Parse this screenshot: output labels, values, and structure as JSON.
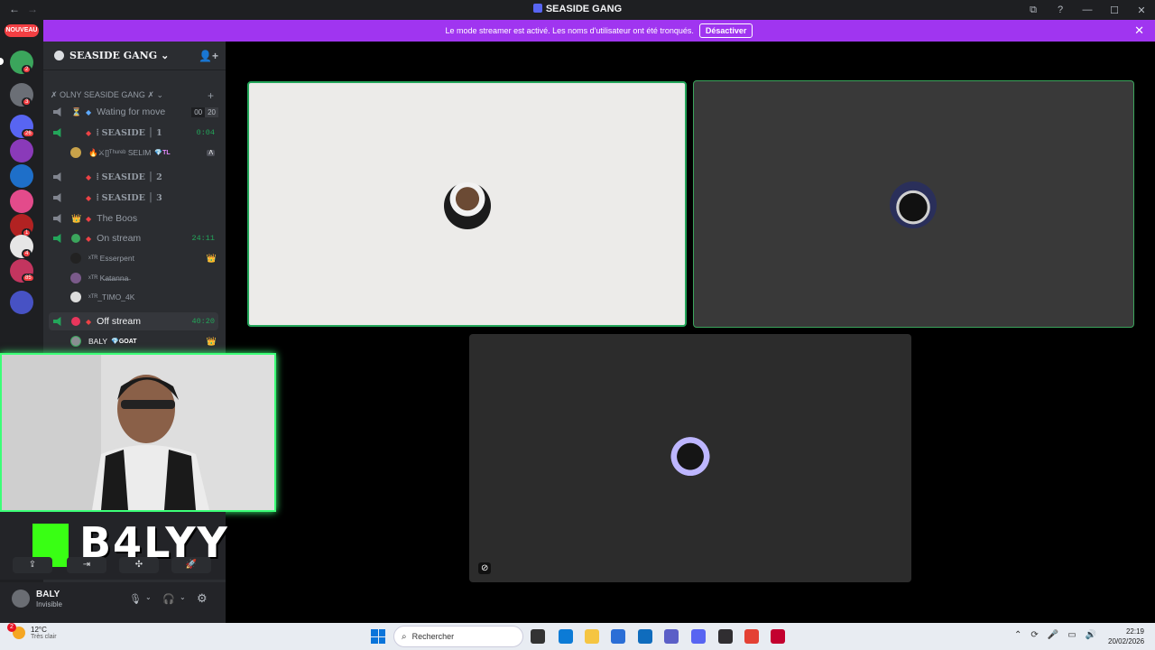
{
  "window": {
    "title": "SEASIDE GANG",
    "back": "←",
    "forward": "→",
    "icons": [
      "⧉",
      "?",
      "—",
      "☐",
      "✕"
    ]
  },
  "banner": {
    "text": "Le mode streamer est activé. Les noms d'utilisateur ont été tronqués.",
    "button": "Désactiver",
    "close": "✕"
  },
  "guilds": {
    "new_badge": "NOUVEAU",
    "items": [
      {
        "color": "#3ba55c",
        "badge": "2"
      },
      {
        "color": "#6b6f76",
        "badge": "3"
      },
      {
        "color": "#5865f2",
        "badge": "26"
      },
      {
        "color": "#8a3ab9",
        "badge": ""
      },
      {
        "color": "#1e6fc9",
        "badge": ""
      },
      {
        "color": "#e34b8b",
        "badge": ""
      },
      {
        "color": "#b22222",
        "badge": "1"
      },
      {
        "color": "#e6e6e6",
        "badge": "4"
      },
      {
        "color": "#c3355f",
        "badge": "85"
      },
      {
        "color": "#4752c4",
        "badge": ""
      }
    ]
  },
  "server": {
    "name": "SEASIDE GANG",
    "chevron": "⌄",
    "invite_icon": "👤+"
  },
  "category": {
    "name": "✗ OLNY SEASIDE GANG ✗",
    "chevron": "⌄",
    "plus": "+"
  },
  "channels": [
    {
      "name": "Wating for move",
      "emoji": "⏳",
      "diamond": "blue",
      "limit_a": "00",
      "limit_b": "20"
    },
    {
      "name": "⦙ SEASIDE │ 1",
      "diamond": "red",
      "time": "0:04",
      "bold": true
    },
    {
      "name": "⦙ SEASIDE │ 2",
      "diamond": "red",
      "bold": true
    },
    {
      "name": "⦙ SEASIDE │ 3",
      "diamond": "red",
      "bold": true
    },
    {
      "name": "The Boos",
      "emoji": "👑",
      "diamond": "red"
    },
    {
      "name": "On stream",
      "diamond": "red",
      "time": "24:11"
    },
    {
      "name": "Off stream",
      "diamond": "red",
      "time": "40:20"
    }
  ],
  "members": {
    "seaside1": {
      "name": "🔥⚔[]ᵀʰᵘʳᵉᵇ SELIM",
      "tag": "💎TL"
    },
    "on_stream": [
      {
        "name": "ˣᵀᴿ Esserpent",
        "crown": "👑"
      },
      {
        "name": "ˣᵀᴿ K̶a̶t̶a̶n̶n̶a̶"
      },
      {
        "name": "ˣᵀᴿ_TIMO_4K"
      }
    ],
    "off_stream": {
      "name": "BALY",
      "tag": "💎GOAT",
      "crown": "👑"
    }
  },
  "overlay": {
    "logo_text": "B4LYY"
  },
  "controls": [
    "⇪",
    "⇥",
    "✣",
    "🚀"
  ],
  "userbar": {
    "name": "BALY",
    "status": "Invisible",
    "mic": "🎙",
    "headset": "🎧",
    "settings": "⚙"
  },
  "stage": {
    "camera_off_icon": "⊘"
  },
  "taskbar": {
    "temp": "12°C",
    "weather": "Très clair",
    "weather_badge": "2",
    "search": "Rechercher",
    "search_icon": "⌕",
    "apps": [
      {
        "name": "task-view",
        "color": "#333"
      },
      {
        "name": "edge",
        "color": "#0c7bd6"
      },
      {
        "name": "files",
        "color": "#f5c542"
      },
      {
        "name": "store",
        "color": "#2b6ed6"
      },
      {
        "name": "outlook",
        "color": "#0f6cbd"
      },
      {
        "name": "teams",
        "color": "#5b5fc7"
      },
      {
        "name": "discord",
        "color": "#5865f2"
      },
      {
        "name": "obs",
        "color": "#302e31"
      },
      {
        "name": "chrome",
        "color": "#e44134"
      },
      {
        "name": "app",
        "color": "#c3002f"
      }
    ],
    "tray_icons": [
      "⌃",
      "⟳",
      "🎤",
      "▭",
      "🔊"
    ],
    "time": "22:19",
    "date": "20/02/2026"
  }
}
